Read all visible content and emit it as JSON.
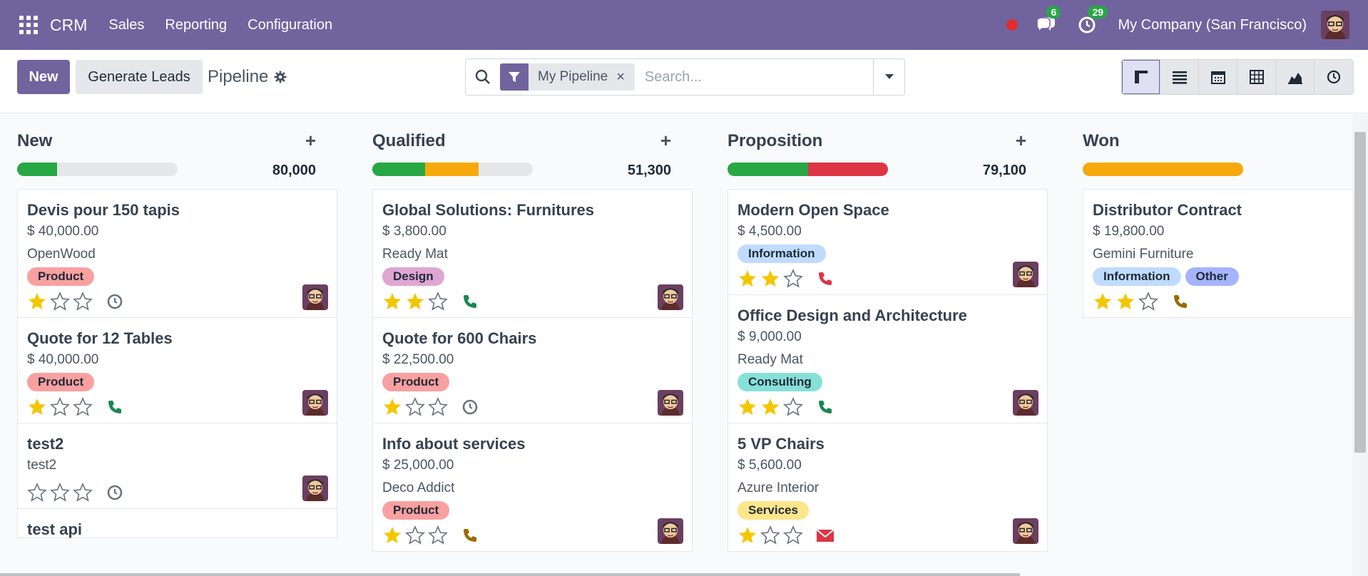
{
  "navbar": {
    "app_name": "CRM",
    "menu": [
      "Sales",
      "Reporting",
      "Configuration"
    ],
    "messages_count": "6",
    "activities_count": "29",
    "company": "My Company (San Francisco)",
    "icons": [
      "apps-grid-icon",
      "record-dot-icon",
      "chat-icon",
      "clock-icon",
      "user-avatar"
    ]
  },
  "control": {
    "new_label": "New",
    "generate_label": "Generate Leads",
    "title": "Pipeline",
    "facet_label": "My Pipeline",
    "facet_close": "×",
    "search_placeholder": "Search...",
    "views": [
      "kanban-view",
      "list-view",
      "calendar-view",
      "pivot-view",
      "graph-view",
      "activity-view"
    ]
  },
  "colors": {
    "brand": "#71639e",
    "green": "#28a745",
    "orange": "#f7a90b",
    "red": "#dc3545",
    "grey": "#e5e7eb",
    "star": "#f3c700",
    "tag_product": "#f9a0a0",
    "tag_design": "#dfa6d2",
    "tag_information": "#bfdbfe",
    "tag_consulting": "#86e0d8",
    "tag_services": "#fde68a",
    "tag_other": "#a5b4fc"
  },
  "columns": [
    {
      "name": "New",
      "add": "+",
      "total": "80,000",
      "progress": [
        {
          "color": "#28a745",
          "fraction": 0.25
        }
      ],
      "cards": [
        {
          "title": "Devis pour 150 tapis",
          "amount": "$ 40,000.00",
          "company": "OpenWood",
          "tags": [
            {
              "label": "Product",
              "color": "#f9a0a0"
            }
          ],
          "stars": 1,
          "activity": "clock",
          "activity_color": "#6b7280"
        },
        {
          "title": "Quote for 12 Tables",
          "amount": "$ 40,000.00",
          "company": "",
          "tags": [
            {
              "label": "Product",
              "color": "#f9a0a0"
            }
          ],
          "stars": 1,
          "activity": "phone",
          "activity_color": "#198754"
        },
        {
          "title": "test2",
          "amount": "test2",
          "company": "",
          "tags": [],
          "stars": 0,
          "activity": "clock",
          "activity_color": "#6b7280"
        },
        {
          "title": "test api",
          "amount": "",
          "company": "",
          "tags": [],
          "stars": 0,
          "activity": "",
          "activity_color": "",
          "cut": true
        }
      ]
    },
    {
      "name": "Qualified",
      "add": "+",
      "total": "51,300",
      "progress": [
        {
          "color": "#28a745",
          "fraction": 0.33
        },
        {
          "color": "#f7a90b",
          "fraction": 0.33
        }
      ],
      "cards": [
        {
          "title": "Global Solutions: Furnitures",
          "amount": "$ 3,800.00",
          "company": "Ready Mat",
          "tags": [
            {
              "label": "Design",
              "color": "#dfa6d2"
            }
          ],
          "stars": 2,
          "activity": "phone",
          "activity_color": "#198754"
        },
        {
          "title": "Quote for 600 Chairs",
          "amount": "$ 22,500.00",
          "company": "",
          "tags": [
            {
              "label": "Product",
              "color": "#f9a0a0"
            }
          ],
          "stars": 1,
          "activity": "clock",
          "activity_color": "#6b7280"
        },
        {
          "title": "Info about services",
          "amount": "$ 25,000.00",
          "company": "Deco Addict",
          "tags": [
            {
              "label": "Product",
              "color": "#f9a0a0"
            }
          ],
          "stars": 1,
          "activity": "phone",
          "activity_color": "#9a6b00",
          "cut": true
        }
      ]
    },
    {
      "name": "Proposition",
      "add": "+",
      "total": "79,100",
      "progress": [
        {
          "color": "#28a745",
          "fraction": 0.5
        },
        {
          "color": "#dc3545",
          "fraction": 0.5
        }
      ],
      "cards": [
        {
          "title": "Modern Open Space",
          "amount": "$ 4,500.00",
          "company": "",
          "tags": [
            {
              "label": "Information",
              "color": "#bfdbfe"
            }
          ],
          "stars": 2,
          "activity": "phone",
          "activity_color": "#dc3545"
        },
        {
          "title": "Office Design and Architecture",
          "amount": "$ 9,000.00",
          "company": "Ready Mat",
          "tags": [
            {
              "label": "Consulting",
              "color": "#86e0d8"
            }
          ],
          "stars": 2,
          "activity": "phone",
          "activity_color": "#198754"
        },
        {
          "title": "5 VP Chairs",
          "amount": "$ 5,600.00",
          "company": "Azure Interior",
          "tags": [
            {
              "label": "Services",
              "color": "#fde68a"
            }
          ],
          "stars": 1,
          "activity": "mail",
          "activity_color": "#dc3545",
          "cut": true
        }
      ]
    },
    {
      "name": "Won",
      "add": "",
      "total": "",
      "progress": [
        {
          "color": "#f7a90b",
          "fraction": 1.0
        }
      ],
      "cards": [
        {
          "title": "Distributor Contract",
          "amount": "$ 19,800.00",
          "company": "Gemini Furniture",
          "tags": [
            {
              "label": "Information",
              "color": "#bfdbfe"
            },
            {
              "label": "Other",
              "color": "#a5b4fc"
            }
          ],
          "stars": 2,
          "activity": "phone",
          "activity_color": "#9a6b00"
        }
      ]
    }
  ]
}
